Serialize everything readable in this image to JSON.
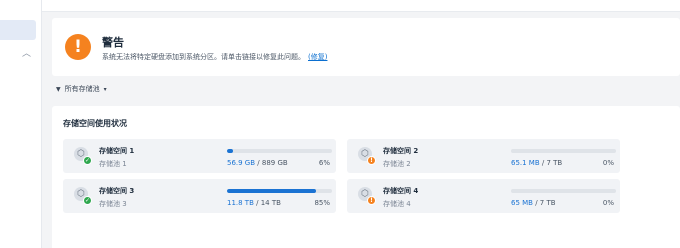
{
  "sidebar": {},
  "alert": {
    "title": "警告",
    "message": "系统无法将特定硬盘添加到系统分区。请单击链接以修复此问题。",
    "link": "(修复)"
  },
  "filter": {
    "label": "所有存储池"
  },
  "panel": {
    "title": "存储空间使用状况"
  },
  "cards": [
    {
      "name": "存储空间 1",
      "pool": "存储池 1",
      "used": "56.9 GB",
      "total": "/ 889 GB",
      "percent": "6%",
      "fraction": 0.06,
      "status": "ok"
    },
    {
      "name": "存储空间 2",
      "pool": "存储池 2",
      "used": "65.1 MB",
      "total": "/ 7 TB",
      "percent": "0%",
      "fraction": 0.0,
      "status": "warn"
    },
    {
      "name": "存储空间 3",
      "pool": "存储池 3",
      "used": "11.8 TB",
      "total": "/ 14 TB",
      "percent": "85%",
      "fraction": 0.85,
      "status": "ok"
    },
    {
      "name": "存储空间 4",
      "pool": "存储池 4",
      "used": "65 MB",
      "total": "/ 7 TB",
      "percent": "0%",
      "fraction": 0.0,
      "status": "warn"
    }
  ],
  "colors": {
    "accent": "#1b73d3",
    "warning": "#f5821f",
    "ok": "#2fa84f"
  }
}
